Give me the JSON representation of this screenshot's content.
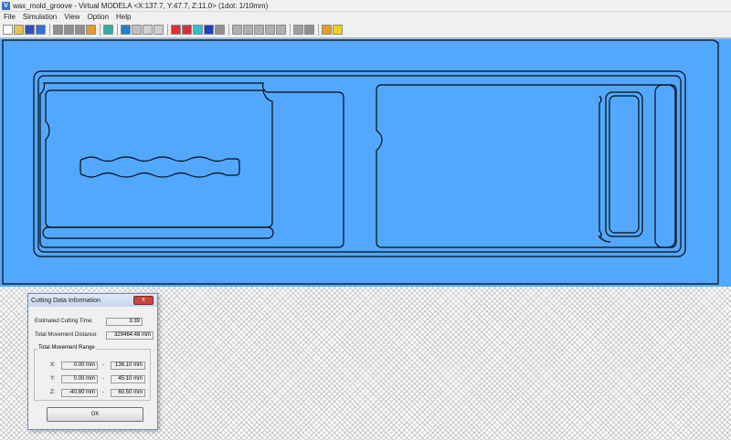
{
  "window": {
    "title": "wax_mold_groove - Virtual MODELA <X:137.7, Y:47.7, Z:11.0> (1dot: 1/10mm)",
    "icon": "v-logo-icon"
  },
  "menu": [
    "File",
    "Simulation",
    "View",
    "Option",
    "Help"
  ],
  "toolbar_buttons": [
    {
      "name": "new-icon",
      "color": "#ffffff"
    },
    {
      "name": "open-icon",
      "color": "#e8c050"
    },
    {
      "name": "save-icon",
      "color": "#3050c0"
    },
    {
      "name": "reload-icon",
      "color": "#3070d0"
    },
    {
      "name": "stop-icon",
      "color": "#909090"
    },
    {
      "name": "play-icon",
      "color": "#909090"
    },
    {
      "name": "step-icon",
      "color": "#909090"
    },
    {
      "name": "cutting-data-icon",
      "color": "#e0a030"
    },
    {
      "name": "shade-icon",
      "color": "#30b0a0"
    },
    {
      "name": "contour-icon",
      "color": "#2080d0"
    },
    {
      "name": "tool-icon",
      "color": "#c0c0c0"
    },
    {
      "name": "line-icon",
      "color": "#d0d0d0"
    },
    {
      "name": "path-icon",
      "color": "#d0d0d0"
    },
    {
      "name": "red-box-icon",
      "color": "#e03030"
    },
    {
      "name": "red-white-icon",
      "color": "#d03040"
    },
    {
      "name": "cyan-box-icon",
      "color": "#30c0d0"
    },
    {
      "name": "blue-box-icon",
      "color": "#2040c0"
    },
    {
      "name": "sphere-icon",
      "color": "#909090"
    },
    {
      "name": "zoom-in-icon",
      "color": "#b0b0b0"
    },
    {
      "name": "zoom-out-icon",
      "color": "#b0b0b0"
    },
    {
      "name": "zoom-fit-icon",
      "color": "#b0b0b0"
    },
    {
      "name": "zoom-area-icon",
      "color": "#b0b0b0"
    },
    {
      "name": "rotate-icon",
      "color": "#b0b0b0"
    },
    {
      "name": "view-top-icon",
      "color": "#a0a0a0"
    },
    {
      "name": "view-front-icon",
      "color": "#909090"
    },
    {
      "name": "palette-icon",
      "color": "#e0a020"
    },
    {
      "name": "light-icon",
      "color": "#f0d020"
    }
  ],
  "workspace": {
    "color": "#52a8ff"
  },
  "dialog": {
    "title": "Cutting Data Information",
    "close_label": "x",
    "estimated_time_label": "Estimated Cutting Time:",
    "estimated_time_value": "3:39",
    "total_distance_label": "Total Movement Distance:",
    "total_distance_value": "329464.48 mm",
    "range_group_label": "Total Movement Range",
    "x_label": "X:",
    "x_min": "0.00 mm",
    "x_max": "136.10 mm",
    "y_label": "Y:",
    "y_min": "0.00 mm",
    "y_max": "45.10 mm",
    "z_label": "Z:",
    "z_min": "-40.80 mm",
    "z_max": "60.50 mm",
    "range_separator": "-",
    "ok_label": "OK"
  }
}
